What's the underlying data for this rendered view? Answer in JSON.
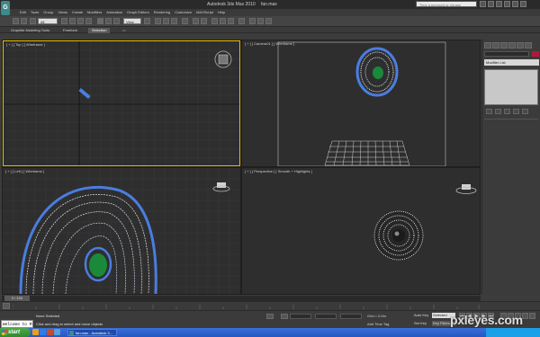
{
  "window": {
    "title": "Autodesk 3ds Max  2010",
    "file": "fan.max",
    "logo_letter": "G",
    "search_placeholder": "Type a keyword or phrase"
  },
  "menu": [
    "Edit",
    "Tools",
    "Group",
    "Views",
    "Create",
    "Modifiers",
    "Animation",
    "Graph Editors",
    "Rendering",
    "Customize",
    "MAXScript",
    "Help"
  ],
  "toolbar": {
    "selection_filter": "All",
    "ref_coord": "View"
  },
  "ribbon": {
    "tabs": [
      "Graphite Modeling Tools",
      "Freeform",
      "Selection"
    ]
  },
  "viewports": {
    "top": "[ + ] [ Top ] [ Wireframe ]",
    "camera": "[ + ] [ Camera01 ] [ Wireframe ]",
    "left": "[ + ] [ Left ] [ Wireframe ]",
    "perspective": "[ + ] [ Perspective ] [ Smooth + Highlights ]"
  },
  "command_panel": {
    "modifier_list": "Modifier List"
  },
  "timeslider": {
    "frame": "0 / 100"
  },
  "status": {
    "selected": "None Selected",
    "prompt": "Click and drag to select and move objects",
    "maxscript": "Welcome to M",
    "grid": "Grid = 0.0m",
    "add_time_tag": "Add Time Tag",
    "auto_key": "Auto Key",
    "auto_key_value": "Selected",
    "set_key": "Set Key",
    "key_filters": "Key Filters..."
  },
  "taskbar": {
    "start": "start",
    "task": "fan.max - Autodesk 3..."
  },
  "watermark": "pxleyes.com",
  "colors": {
    "selection_color": "#b0183a",
    "wire_white": "#e8e8e8",
    "wire_blue": "#4a7de0",
    "fan_green": "#1a8a3a"
  }
}
